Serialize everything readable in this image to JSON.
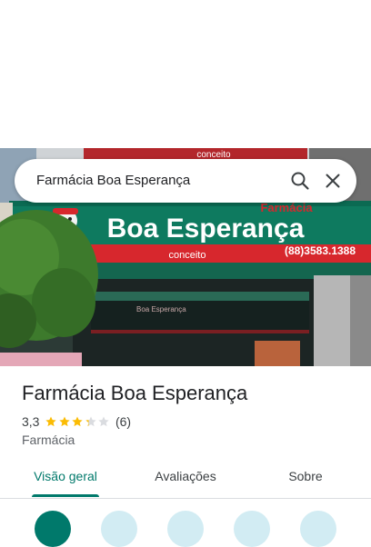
{
  "search": {
    "query": "Farmácia Boa Esperança"
  },
  "storefront": {
    "brand_top": "conceito",
    "brand_small": "Farmácia",
    "brand_main": "Boa Esperança",
    "brand_sub": "conceito",
    "phone": "(88)3583.1388",
    "awning_text": "Boa Esperança"
  },
  "place": {
    "name": "Farmácia Boa Esperança",
    "rating": "3,3",
    "rating_value": 3.3,
    "review_count": "(6)",
    "category": "Farmácia"
  },
  "tabs": [
    {
      "label": "Visão geral",
      "active": true
    },
    {
      "label": "Avaliações",
      "active": false
    },
    {
      "label": "Sobre",
      "active": false
    }
  ],
  "colors": {
    "accent": "#00796b",
    "star": "#fbbc04",
    "star_empty": "#dadce0",
    "sign_green": "#0e7a5f",
    "sign_red": "#d7272d"
  },
  "icons": [
    "search-icon",
    "close-icon",
    "star-icon"
  ]
}
